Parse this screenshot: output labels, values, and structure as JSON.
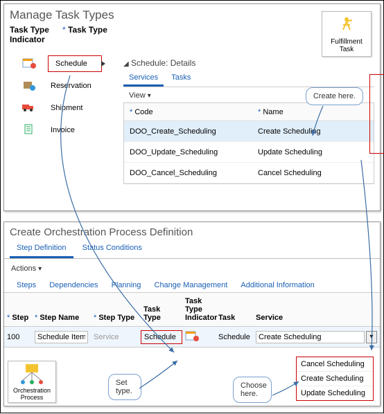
{
  "top": {
    "title": "Manage Task Types",
    "badge": {
      "label": "Fulfillment Task"
    },
    "col_indicator": "Task Type Indicator",
    "col_tasktype": "Task Type",
    "sidebar": [
      {
        "label": "Schedule",
        "icon": "schedule-icon"
      },
      {
        "label": "Reservation",
        "icon": "reservation-icon"
      },
      {
        "label": "Shipment",
        "icon": "shipment-icon"
      },
      {
        "label": "Invoice",
        "icon": "invoice-icon"
      }
    ],
    "detail_title": "Schedule: Details",
    "tabs": [
      "Services",
      "Tasks"
    ],
    "active_tab": "Services",
    "view_label": "View",
    "table": {
      "headers": {
        "code": "Code",
        "name": "Name"
      },
      "rows": [
        {
          "code": "DOO_Create_Scheduling",
          "name": "Create Scheduling"
        },
        {
          "code": "DOO_Update_Scheduling",
          "name": "Update Scheduling"
        },
        {
          "code": "DOO_Cancel_Scheduling",
          "name": "Cancel Scheduling"
        }
      ]
    },
    "callout_create": "Create here."
  },
  "bottom": {
    "title": "Create Orchestration Process Definition",
    "tabs": [
      "Step Definition",
      "Status Conditions"
    ],
    "active_tab": "Step Definition",
    "actions_label": "Actions",
    "subtabs": [
      "Steps",
      "Dependencies",
      "Planning",
      "Change Management",
      "Additional Information"
    ],
    "columns": {
      "step": "Step",
      "step_name": "Step Name",
      "step_type": "Step Type",
      "task_type": "Task Type",
      "tti": "Task Type Indicator",
      "task": "Task",
      "service": "Service"
    },
    "row": {
      "step": "100",
      "step_name": "Schedule Item",
      "step_type": "Service",
      "task_type": "Schedule",
      "task": "Schedule",
      "service": "Create Scheduling"
    },
    "dropdown": [
      "Cancel Scheduling",
      "Create Scheduling",
      "Update Scheduling"
    ],
    "callout_set": "Set type.",
    "callout_choose": "Choose here.",
    "op_badge": "Orchestration Process"
  }
}
